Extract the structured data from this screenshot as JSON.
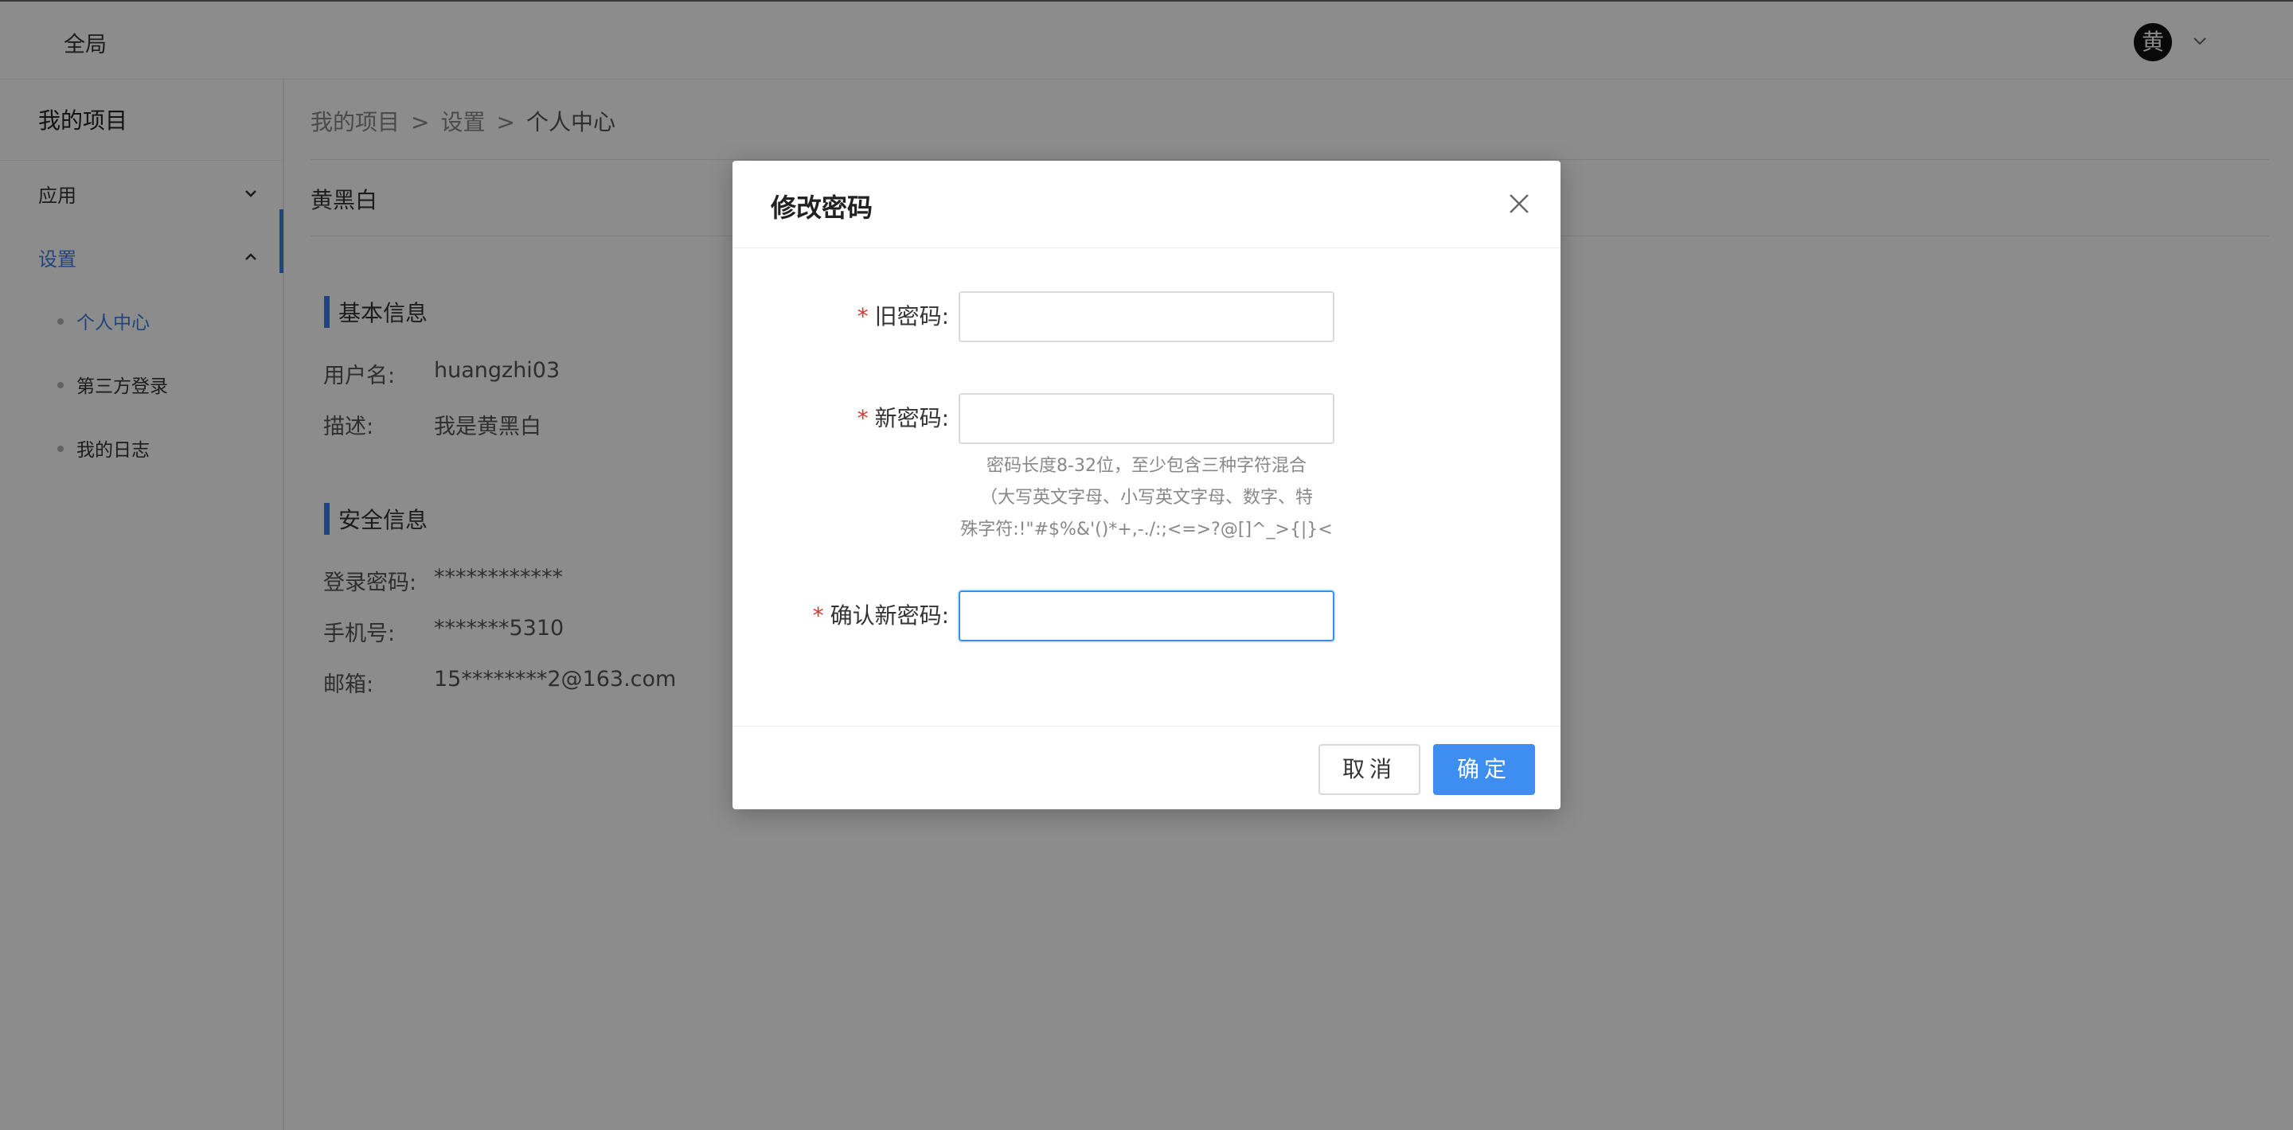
{
  "header": {
    "brand": "全局",
    "avatar_char": "黄"
  },
  "sidebar": {
    "project_title": "我的项目",
    "menu": [
      {
        "label": "应用",
        "expanded": false
      },
      {
        "label": "设置",
        "expanded": true
      }
    ],
    "sub_items": [
      {
        "label": "个人中心",
        "active": true
      },
      {
        "label": "第三方登录",
        "active": false
      },
      {
        "label": "我的日志",
        "active": false
      }
    ]
  },
  "main": {
    "breadcrumb": [
      "我的项目",
      "设置",
      "个人中心"
    ],
    "breadcrumb_separator": ">",
    "username_title": "黄黑白",
    "basic_info": {
      "title": "基本信息",
      "rows": [
        {
          "label": "用户名:",
          "value": "huangzhi03"
        },
        {
          "label": "描述:",
          "value": "我是黄黑白"
        }
      ]
    },
    "security_info": {
      "title": "安全信息",
      "rows": [
        {
          "label": "登录密码:",
          "value": "************"
        },
        {
          "label": "手机号:",
          "value": "*******5310"
        },
        {
          "label": "邮箱:",
          "value": "15********2@163.com"
        }
      ]
    }
  },
  "modal": {
    "title": "修改密码",
    "required_mark": "*",
    "fields": {
      "old_password": {
        "label": "旧密码:",
        "value": ""
      },
      "new_password": {
        "label": "新密码:",
        "value": ""
      },
      "confirm_password": {
        "label": "确认新密码:",
        "value": ""
      }
    },
    "hint_lines": [
      "密码长度8-32位，至少包含三种字符混合",
      "（大写英文字母、小写英文字母、数字、特",
      "殊字符:!\"#$%&'()*+,-./:;<=>?@[]^_>{|}<"
    ],
    "cancel_label": "取消",
    "ok_label": "确定"
  },
  "colors": {
    "accent": "#3b7de0",
    "primary_button": "#3d8ef0",
    "required": "#e0322c",
    "overlay": "rgba(0,0,0,0.45)"
  },
  "icons": {
    "user_menu": "chevron-down-icon",
    "menu_collapsed": "chevron-down-icon",
    "menu_expanded": "chevron-up-icon",
    "modal_close": "close-icon"
  }
}
